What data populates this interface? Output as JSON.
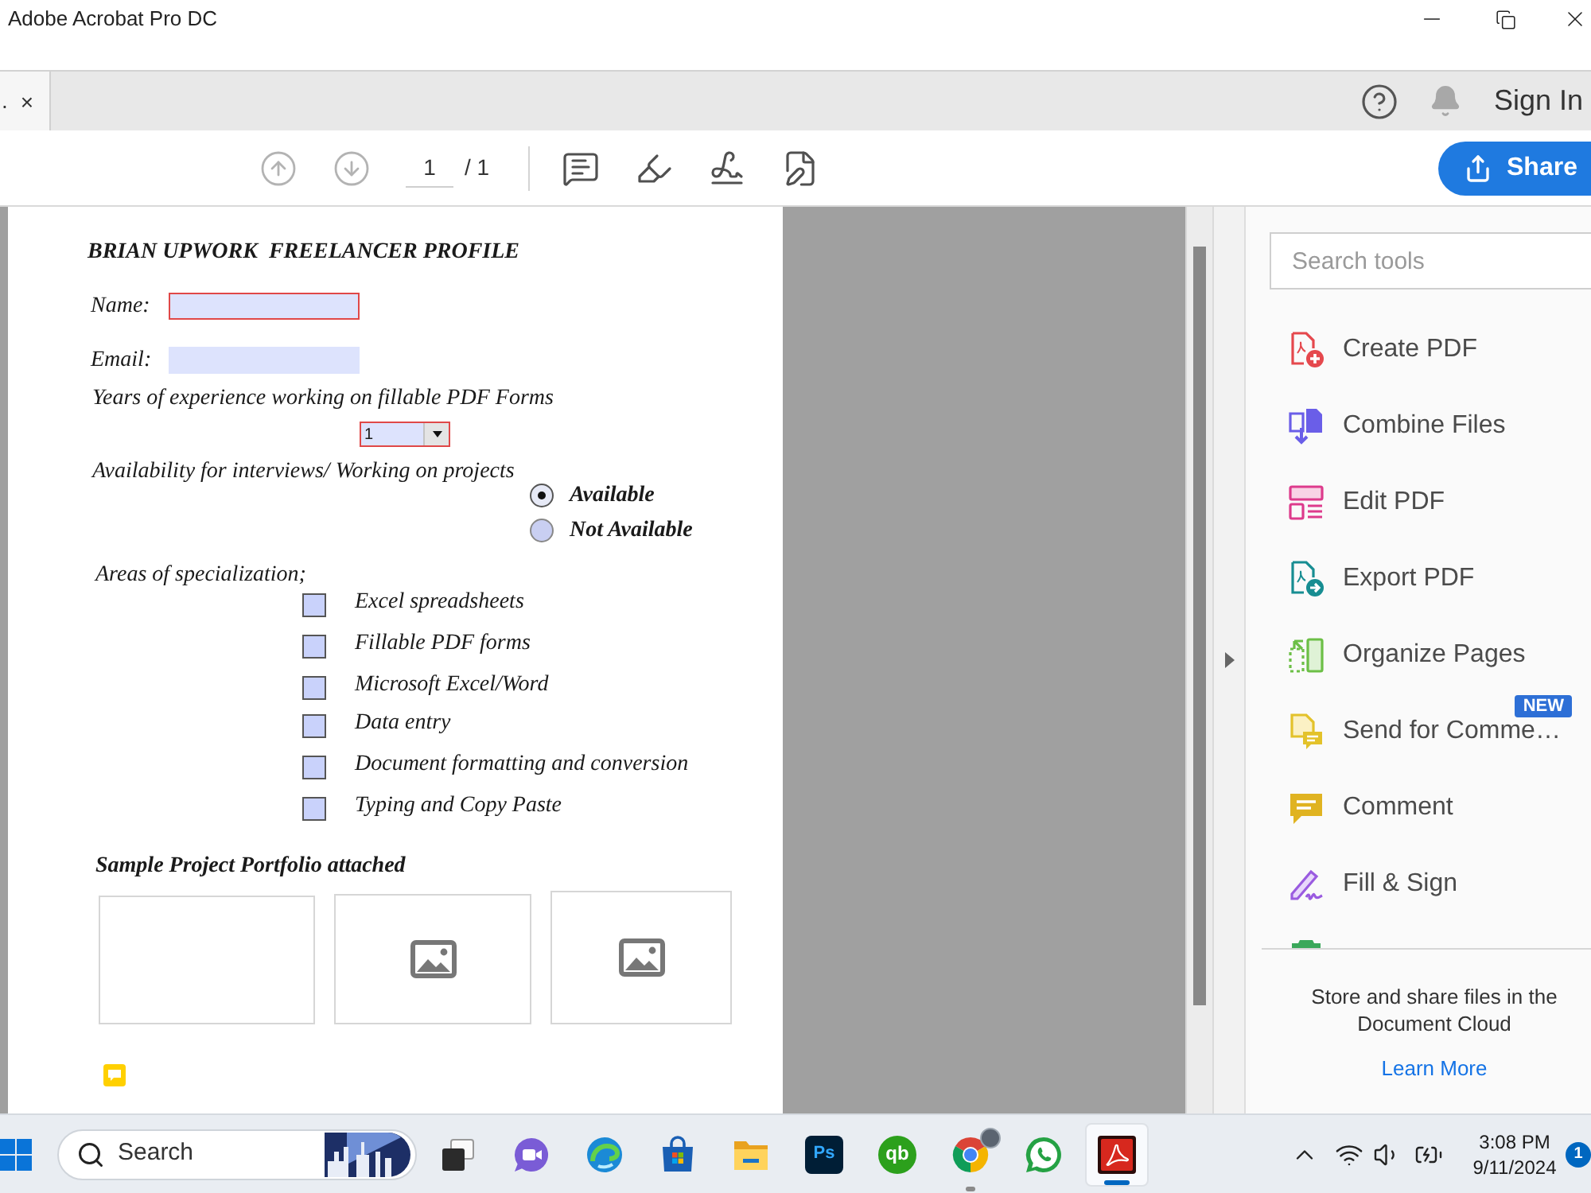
{
  "window": {
    "title": "Adobe Acrobat Pro DC"
  },
  "tab": {
    "label": ".",
    "close": "×"
  },
  "header": {
    "sign_in": "Sign In"
  },
  "toolbar": {
    "nav": [
      {
        "kind": "previous-page",
        "disabled": true
      },
      {
        "kind": "next-page",
        "disabled": true
      }
    ],
    "page": "1",
    "page_total": "/ 1",
    "tools": [
      {
        "kind": "comment"
      },
      {
        "kind": "highlight"
      },
      {
        "kind": "sign"
      },
      {
        "kind": "edit"
      }
    ],
    "share": "Share"
  },
  "document": {
    "title": "BRIAN UPWORK  FREELANCER PROFILE",
    "fields": [
      {
        "label": "Name:",
        "required": true
      },
      {
        "label": "Email:",
        "required": false
      }
    ],
    "experience": {
      "label": "Years of experience working on fillable PDF Forms",
      "value": "1",
      "required": true
    },
    "availability": {
      "label": "Availability for interviews/ Working on projects",
      "options": [
        {
          "label": "Available",
          "selected": true
        },
        {
          "label": "Not Available",
          "selected": false
        }
      ]
    },
    "specialization": {
      "label": "Areas of specialization;",
      "options": [
        {
          "label": "Excel spreadsheets",
          "checked": false
        },
        {
          "label": "Fillable PDF forms",
          "checked": false
        },
        {
          "label": "Microsoft Excel/Word",
          "checked": false
        },
        {
          "label": "Data entry",
          "checked": false
        },
        {
          "label": "Document formatting and conversion",
          "checked": false
        },
        {
          "label": "Typing and Copy Paste",
          "checked": false
        }
      ]
    },
    "portfolio": {
      "label": "Sample Project Portfolio attached",
      "slots": [
        {
          "kind": "empty"
        },
        {
          "kind": "image"
        },
        {
          "kind": "image"
        }
      ]
    }
  },
  "tools_panel": {
    "search": {
      "placeholder": "Search tools"
    },
    "tools": [
      {
        "kind": "create-pdf",
        "label": "Create PDF"
      },
      {
        "kind": "combine-files",
        "label": "Combine Files"
      },
      {
        "kind": "edit-pdf",
        "label": "Edit PDF"
      },
      {
        "kind": "export-pdf",
        "label": "Export PDF"
      },
      {
        "kind": "organize-pages",
        "label": "Organize Pages"
      },
      {
        "kind": "send-for-comment",
        "label": "Send for Comme…",
        "badge": "NEW"
      },
      {
        "kind": "comment",
        "label": "Comment"
      },
      {
        "kind": "fill-sign",
        "label": "Fill & Sign"
      }
    ],
    "promo": {
      "text": "Store and share files in the Document Cloud",
      "link": "Learn More"
    }
  },
  "taskbar": {
    "search": {
      "placeholder": "Search"
    },
    "apps": [
      {
        "kind": "task-view",
        "running": false,
        "active": false
      },
      {
        "kind": "video-call",
        "running": false,
        "active": false
      },
      {
        "kind": "edge",
        "running": false,
        "active": false
      },
      {
        "kind": "store",
        "running": false,
        "active": false
      },
      {
        "kind": "files",
        "running": false,
        "active": false
      },
      {
        "kind": "photoshop",
        "label": "Ps",
        "running": false,
        "active": false
      },
      {
        "kind": "quickbooks",
        "label": "qb",
        "running": false,
        "active": false
      },
      {
        "kind": "chrome",
        "running": true,
        "active": false
      },
      {
        "kind": "whatsapp",
        "running": false,
        "active": false
      },
      {
        "kind": "acrobat",
        "running": true,
        "active": true
      }
    ],
    "time": "3:08 PM",
    "date": "9/11/2024",
    "notifications": "1"
  }
}
